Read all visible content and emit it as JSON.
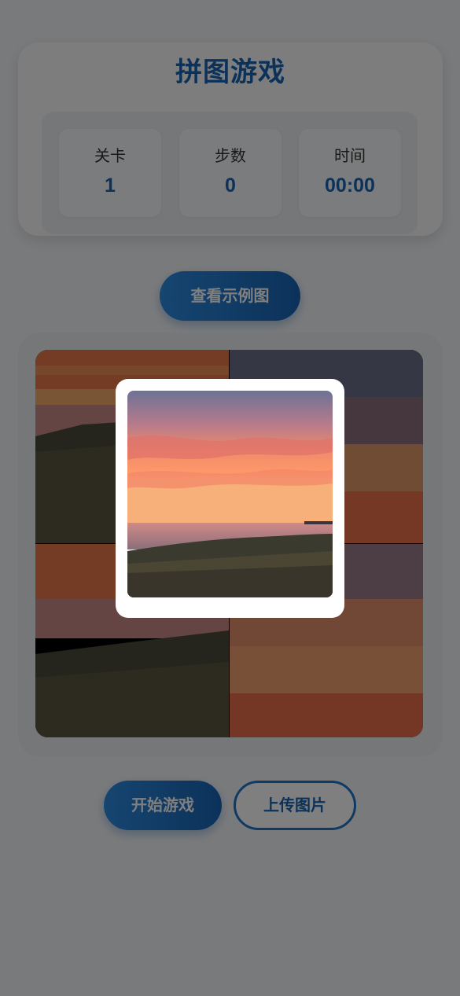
{
  "header": {
    "title": "拼图游戏"
  },
  "stats": [
    {
      "label": "关卡",
      "value": "1"
    },
    {
      "label": "步数",
      "value": "0"
    },
    {
      "label": "时间",
      "value": "00:00"
    }
  ],
  "buttons": {
    "view_example": "查看示例图",
    "start_game": "开始游戏",
    "upload_image": "上传图片"
  },
  "puzzle": {
    "grid": "2x2",
    "image": "sunset-over-sea-and-grass"
  },
  "colors": {
    "accent": "#1864b4",
    "overlay": "rgba(0,0,0,0.5)"
  }
}
